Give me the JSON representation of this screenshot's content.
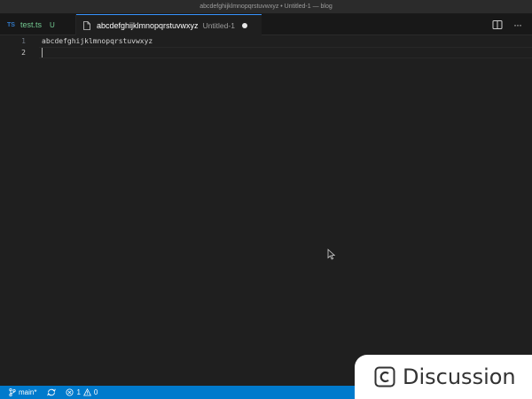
{
  "window": {
    "title": "abcdefghijklmnopqrstuvwxyz • Untitled-1 — blog"
  },
  "tabs": [
    {
      "icon": "TS",
      "label": "test.ts",
      "badge": "U"
    },
    {
      "label": "abcdefghijklmnopqrstuvwxyz",
      "description": "Untitled-1",
      "dirty": true
    }
  ],
  "editor": {
    "line_numbers": [
      "1",
      "2"
    ],
    "lines": [
      "abcdefghijklmnopqrstuvwxyz",
      ""
    ]
  },
  "statusbar": {
    "branch": "main*",
    "errors": "1",
    "warnings": "0"
  },
  "watermark": {
    "text": "Discussion"
  },
  "colors": {
    "accent": "#007acc",
    "tab_active_border": "#3794ff",
    "untracked": "#73c991"
  }
}
